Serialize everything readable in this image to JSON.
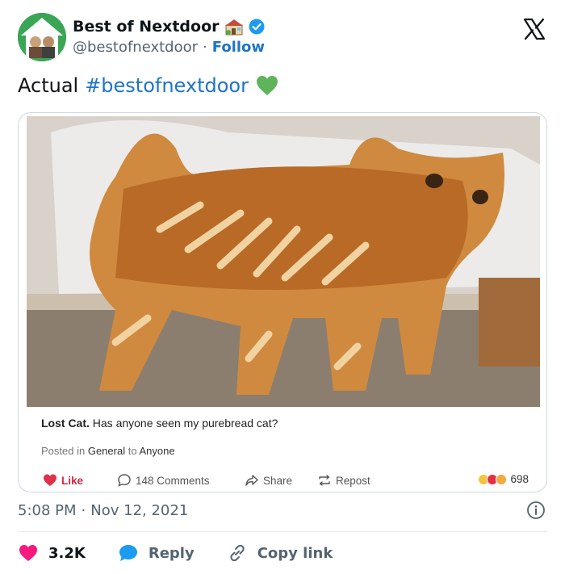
{
  "account": {
    "display_name": "Best of Nextdoor",
    "handle": "@bestofnextdoor",
    "separator": "·",
    "follow_label": "Follow"
  },
  "tweet": {
    "text": "Actual",
    "hashtag": "#bestofnextdoor"
  },
  "embedded_post": {
    "title": "Lost Cat.",
    "body": "Has anyone seen my purebread cat?",
    "posted_prefix": "Posted in",
    "category": "General",
    "to_word": "to",
    "audience": "Anyone",
    "like_label": "Like",
    "comments_label": "148 Comments",
    "share_label": "Share",
    "repost_label": "Repost",
    "reactions_count": "698"
  },
  "meta": {
    "time": "5:08 PM",
    "separator": "·",
    "date": "Nov 12, 2021"
  },
  "footer": {
    "likes": "3.2K",
    "reply_label": "Reply",
    "copy_label": "Copy link"
  },
  "colors": {
    "link_blue": "#1d74c8",
    "heart_pink": "#f91880",
    "reply_blue": "#1d9bf0",
    "green_heart": "#5fb35a"
  },
  "icons": [
    "house-emoji-icon",
    "verified-badge-icon",
    "x-logo-icon",
    "green-heart-icon",
    "like-heart-icon",
    "comment-icon",
    "share-icon",
    "repost-icon",
    "info-icon",
    "heart-icon",
    "reply-bubble-icon",
    "link-icon"
  ]
}
